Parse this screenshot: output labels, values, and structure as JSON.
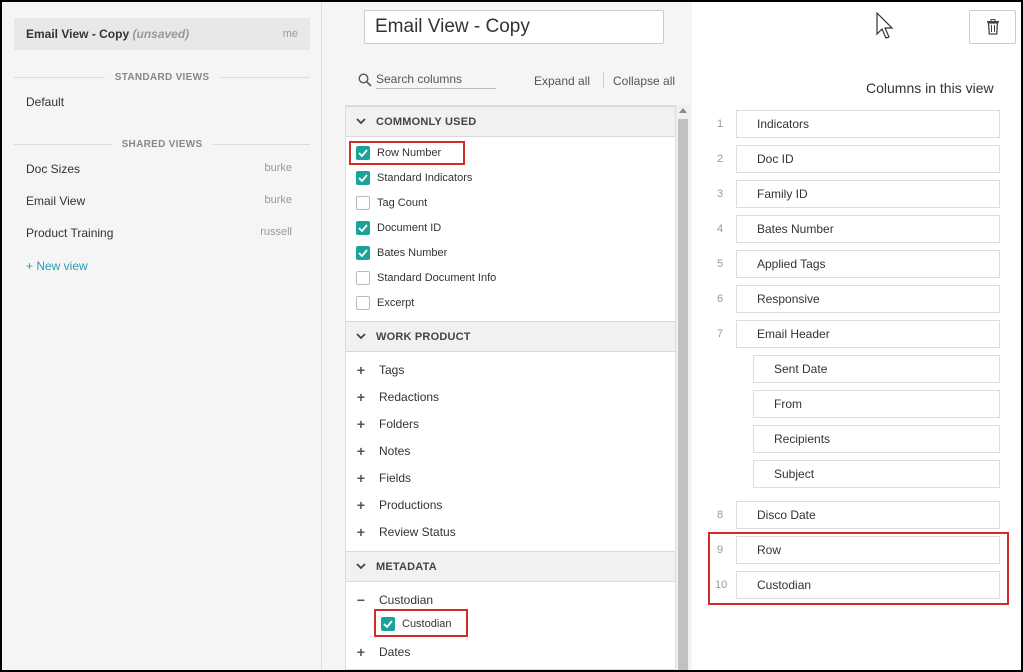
{
  "sidebar": {
    "current_view": {
      "name": "Email View - Copy",
      "status": "(unsaved)",
      "owner": "me"
    },
    "standard_views_title": "STANDARD VIEWS",
    "standard_views": [
      {
        "label": "Default"
      }
    ],
    "shared_views_title": "SHARED VIEWS",
    "shared_views": [
      {
        "label": "Doc Sizes",
        "owner": "burke"
      },
      {
        "label": "Email View",
        "owner": "burke"
      },
      {
        "label": "Product Training",
        "owner": "russell"
      }
    ],
    "new_view_label": "+ New view"
  },
  "header": {
    "view_name_value": "Email View - Copy",
    "delete_icon": "trash-icon"
  },
  "picker": {
    "search_placeholder": "Search columns",
    "expand_all_label": "Expand all",
    "collapse_all_label": "Collapse all",
    "commonly_used": {
      "title": "COMMONLY USED",
      "items": [
        {
          "label": "Row Number",
          "checked": true
        },
        {
          "label": "Standard Indicators",
          "checked": true
        },
        {
          "label": "Tag Count",
          "checked": false
        },
        {
          "label": "Document ID",
          "checked": true
        },
        {
          "label": "Bates Number",
          "checked": true
        },
        {
          "label": "Standard Document Info",
          "checked": false
        },
        {
          "label": "Excerpt",
          "checked": false
        }
      ]
    },
    "work_product": {
      "title": "WORK PRODUCT",
      "items": [
        {
          "label": "Tags"
        },
        {
          "label": "Redactions"
        },
        {
          "label": "Folders"
        },
        {
          "label": "Notes"
        },
        {
          "label": "Fields"
        },
        {
          "label": "Productions"
        },
        {
          "label": "Review Status"
        }
      ]
    },
    "metadata": {
      "title": "METADATA",
      "custodian_group": "Custodian",
      "custodian_item": {
        "label": "Custodian",
        "checked": true
      },
      "dates_group": "Dates"
    }
  },
  "columns_panel": {
    "title": "Columns in this view",
    "items": [
      {
        "num": "1",
        "label": "Indicators"
      },
      {
        "num": "2",
        "label": "Doc ID"
      },
      {
        "num": "3",
        "label": "Family ID"
      },
      {
        "num": "4",
        "label": "Bates Number"
      },
      {
        "num": "5",
        "label": "Applied Tags"
      },
      {
        "num": "6",
        "label": "Responsive"
      },
      {
        "num": "7",
        "label": "Email Header"
      },
      {
        "num": "",
        "label": "Sent Date"
      },
      {
        "num": "",
        "label": "From"
      },
      {
        "num": "",
        "label": "Recipients"
      },
      {
        "num": "",
        "label": "Subject"
      },
      {
        "num": "8",
        "label": "Disco Date"
      },
      {
        "num": "9",
        "label": "Row"
      },
      {
        "num": "10",
        "label": "Custodian"
      }
    ]
  },
  "colors": {
    "accent": "#1aa39b",
    "link": "#2a9bb5",
    "highlight_box": "#d12c2c"
  }
}
